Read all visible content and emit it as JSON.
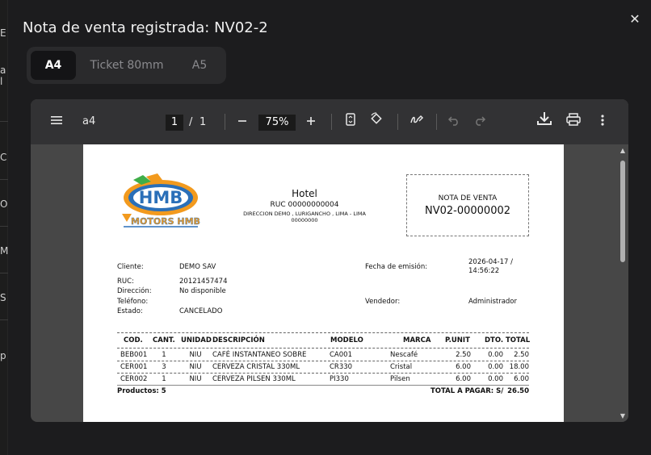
{
  "background": {
    "fragments": [
      {
        "text": "E"
      },
      {
        "text": "a l"
      },
      {
        "text": "C"
      },
      {
        "text": "ON"
      },
      {
        "text": "MI"
      },
      {
        "text": "S"
      },
      {
        "text": "p"
      }
    ]
  },
  "dialog": {
    "title": "Nota de venta registrada: NV02-2",
    "close_icon": "close-icon",
    "tabs": [
      {
        "label": "A4",
        "active": true
      },
      {
        "label": "Ticket 80mm",
        "active": false
      },
      {
        "label": "A5",
        "active": false
      }
    ]
  },
  "viewer": {
    "filename": "a4",
    "current_page": "1",
    "page_sep": "/",
    "total_pages": "1",
    "zoom": "75%",
    "icons": [
      "menu-icon",
      "zoom-out-icon",
      "zoom-in-icon",
      "fit-page-icon",
      "rotate-icon",
      "annotate-icon",
      "undo-icon",
      "redo-icon",
      "download-icon",
      "print-icon",
      "more-icon"
    ]
  },
  "document": {
    "company_name": "Hotel",
    "company_ruc": "RUC 00000000004",
    "company_address": "DIRECCION DEMO , LURIGANCHO , LIMA - LIMA",
    "company_postal": "00000000",
    "logo_text": "MOTORS HMB",
    "logo_letters": "HMB",
    "doc_type": "NOTA DE VENTA",
    "doc_number": "NV02-00000002",
    "fields": {
      "client_label": "Cliente:",
      "client_value": "DEMO SAV",
      "ruc_label": "RUC:",
      "ruc_value": "20121457474",
      "address_label": "Dirección:",
      "address_value": "No disponible",
      "phone_label": "Teléfono:",
      "phone_value": "",
      "status_label": "Estado:",
      "status_value": "CANCELADO",
      "date_label": "Fecha de emisión:",
      "date_value_1": "2026-04-17 /",
      "date_value_2": "14:56:22",
      "seller_label": "Vendedor:",
      "seller_value": "Administrador"
    },
    "table": {
      "headers": [
        "COD.",
        "CANT.",
        "UNIDAD",
        "DESCRIPCIÓN",
        "MODELO",
        "MARCA",
        "P.UNIT",
        "DTO.",
        "TOTAL"
      ],
      "rows": [
        [
          "BEB001",
          "1",
          "NIU",
          "CAFÉ INSTANTANEO SOBRE",
          "CA001",
          "Nescafé",
          "2.50",
          "0.00",
          "2.50"
        ],
        [
          "CER001",
          "3",
          "NIU",
          "CERVEZA CRISTAL 330ML",
          "CR330",
          "Cristal",
          "6.00",
          "0.00",
          "18.00"
        ],
        [
          "CER002",
          "1",
          "NIU",
          "CERVEZA PILSEN 330ML",
          "PI330",
          "Pilsen",
          "6.00",
          "0.00",
          "6.00"
        ]
      ],
      "products_label": "Productos: 5",
      "total_label": "TOTAL A PAGAR: S/",
      "total_value": "26.50"
    }
  }
}
